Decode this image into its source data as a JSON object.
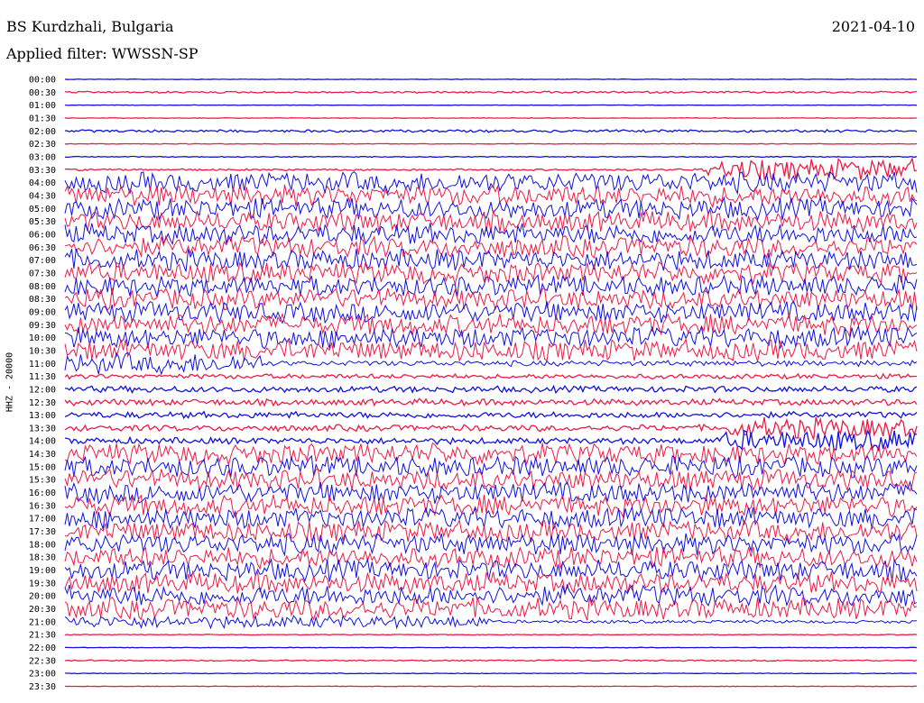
{
  "header": {
    "station": "BS Kurdzhali, Bulgaria",
    "date": "2021-04-10",
    "filter": "Applied filter: WWSSN-SP"
  },
  "chart_data": {
    "type": "line",
    "ylabel": "HHZ - 20000",
    "colors": [
      "#1010e0",
      "#ee1a44"
    ],
    "row_labels": [
      "00:00",
      "00:30",
      "01:00",
      "01:30",
      "02:00",
      "02:30",
      "03:00",
      "03:30",
      "04:00",
      "04:30",
      "05:00",
      "05:30",
      "06:00",
      "06:30",
      "07:00",
      "07:30",
      "08:00",
      "08:30",
      "09:00",
      "09:30",
      "10:00",
      "10:30",
      "11:00",
      "11:30",
      "12:00",
      "12:30",
      "13:00",
      "13:30",
      "14:00",
      "14:30",
      "15:00",
      "15:30",
      "16:00",
      "16:30",
      "17:00",
      "17:30",
      "18:00",
      "18:30",
      "19:00",
      "19:30",
      "20:00",
      "20:30",
      "21:00",
      "21:30",
      "22:00",
      "22:30",
      "23:00",
      "23:30"
    ],
    "row_noise": [
      0.3,
      1.2,
      0.3,
      0.3,
      1.6,
      0.4,
      0.6,
      1.2,
      13,
      13,
      13,
      13,
      13,
      13,
      13,
      13,
      13,
      13,
      13,
      13,
      13,
      13,
      13,
      3,
      4,
      4,
      4,
      4,
      4,
      13,
      13,
      13,
      13,
      13,
      13,
      13,
      13,
      13,
      13,
      13,
      13,
      13,
      8,
      0.5,
      0.3,
      0.8,
      0.4,
      0.3
    ],
    "row_noise_after": [
      null,
      null,
      null,
      null,
      null,
      null,
      null,
      13,
      null,
      null,
      null,
      null,
      null,
      null,
      null,
      null,
      null,
      null,
      null,
      null,
      null,
      null,
      3.5,
      null,
      null,
      null,
      null,
      13,
      13,
      13,
      null,
      null,
      null,
      null,
      null,
      null,
      null,
      null,
      null,
      null,
      null,
      null,
      2,
      null,
      null,
      null,
      null,
      null
    ],
    "row_noise_change": [
      null,
      null,
      null,
      null,
      null,
      null,
      null,
      0.75,
      null,
      null,
      null,
      null,
      null,
      null,
      null,
      null,
      null,
      null,
      null,
      null,
      null,
      null,
      0.23,
      null,
      null,
      null,
      null,
      0.78,
      0.77,
      0.74,
      null,
      null,
      null,
      null,
      null,
      null,
      null,
      null,
      null,
      null,
      null,
      null,
      0.5,
      null,
      null,
      null,
      null,
      null
    ]
  }
}
